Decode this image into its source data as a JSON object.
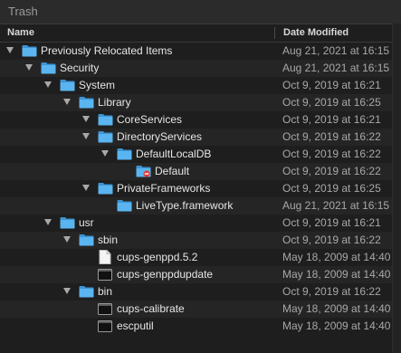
{
  "window": {
    "title": "Trash"
  },
  "columns": {
    "name": "Name",
    "date_modified": "Date Modified"
  },
  "rows": [
    {
      "name": "Previously Relocated Items",
      "date": "Aug 21, 2021 at 16:15",
      "icon": "folder-icon",
      "expanded": true
    },
    {
      "name": "Security",
      "date": "Aug 21, 2021 at 16:15",
      "icon": "folder-icon",
      "expanded": true
    },
    {
      "name": "System",
      "date": "Oct 9, 2019 at 16:21",
      "icon": "folder-icon",
      "expanded": true
    },
    {
      "name": "Library",
      "date": "Oct 9, 2019 at 16:25",
      "icon": "folder-icon",
      "expanded": true
    },
    {
      "name": "CoreServices",
      "date": "Oct 9, 2019 at 16:21",
      "icon": "folder-icon",
      "expanded": false
    },
    {
      "name": "DirectoryServices",
      "date": "Oct 9, 2019 at 16:22",
      "icon": "folder-icon",
      "expanded": true
    },
    {
      "name": "DefaultLocalDB",
      "date": "Oct 9, 2019 at 16:22",
      "icon": "folder-icon",
      "expanded": true
    },
    {
      "name": "Default",
      "date": "Oct 9, 2019 at 16:22",
      "icon": "restricted-folder-icon",
      "expanded": false
    },
    {
      "name": "PrivateFrameworks",
      "date": "Oct 9, 2019 at 16:25",
      "icon": "folder-icon",
      "expanded": true
    },
    {
      "name": "LiveType.framework",
      "date": "Aug 21, 2021 at 16:15",
      "icon": "folder-icon",
      "expanded": false
    },
    {
      "name": "usr",
      "date": "Oct 9, 2019 at 16:21",
      "icon": "folder-icon",
      "expanded": true
    },
    {
      "name": "sbin",
      "date": "Oct 9, 2019 at 16:22",
      "icon": "folder-icon",
      "expanded": true
    },
    {
      "name": "cups-genppd.5.2",
      "date": "May 18, 2009 at 14:40",
      "icon": "document-icon",
      "expanded": false
    },
    {
      "name": "cups-genppdupdate",
      "date": "May 18, 2009 at 14:40",
      "icon": "terminal-icon",
      "expanded": false
    },
    {
      "name": "bin",
      "date": "Oct 9, 2019 at 16:22",
      "icon": "folder-icon",
      "expanded": true
    },
    {
      "name": "cups-calibrate",
      "date": "May 18, 2009 at 14:40",
      "icon": "terminal-icon",
      "expanded": false
    },
    {
      "name": "escputil",
      "date": "May 18, 2009 at 14:40",
      "icon": "terminal-icon",
      "expanded": false
    }
  ],
  "colors": {
    "background": "#1e1e1e",
    "folder": "#5ab4f0",
    "text": "#e6e6e6",
    "secondary_text": "#a8a8a8"
  }
}
